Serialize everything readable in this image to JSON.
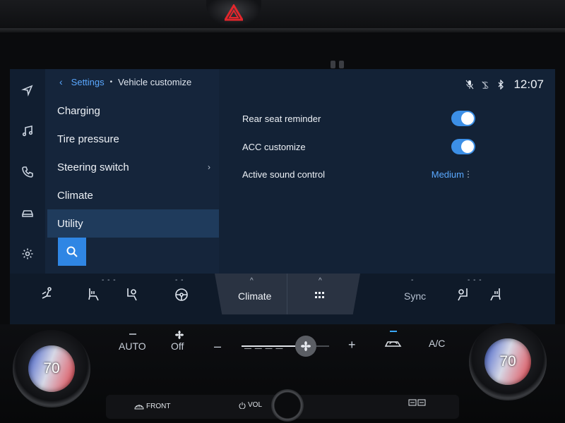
{
  "hazard": {
    "icon": "hazard-icon"
  },
  "breadcrumb": {
    "back_icon": "‹",
    "parent": "Settings",
    "separator": "•",
    "current": "Vehicle customize"
  },
  "side_rail": [
    {
      "icon": "navigation-icon"
    },
    {
      "icon": "music-icon"
    },
    {
      "icon": "phone-icon"
    },
    {
      "icon": "car-icon"
    },
    {
      "icon": "gear-icon"
    }
  ],
  "menu": {
    "items": [
      {
        "label": "Charging"
      },
      {
        "label": "Tire pressure"
      },
      {
        "label": "Steering switch",
        "chevron": "›"
      },
      {
        "label": "Climate"
      },
      {
        "label": "Utility",
        "selected": true
      }
    ]
  },
  "status": {
    "clock": "12:07",
    "icons": [
      "microphone-muted-icon",
      "signal-off-icon",
      "bluetooth-icon"
    ]
  },
  "settings": [
    {
      "label": "Rear seat reminder",
      "type": "toggle",
      "value": true
    },
    {
      "label": "ACC customize",
      "type": "toggle",
      "value": true
    },
    {
      "label": "Active sound control",
      "type": "select",
      "value": "Medium",
      "more": "⋮"
    }
  ],
  "climate_strip": {
    "tabs": [
      {
        "label": "Climate",
        "caret": "^"
      },
      {
        "label": "",
        "caret": "^",
        "icon": "grid-icon"
      }
    ],
    "sync_label": "Sync",
    "level_marks": {
      "left_seat_heat": "- - -",
      "steering": "- -",
      "sync": "-",
      "right_seat_heat": "- - -"
    }
  },
  "controls": {
    "left_temp": "70",
    "right_temp": "70",
    "auto_label": "AUTO",
    "fan_label": "Off",
    "minus": "–",
    "plus": "+",
    "ac_label": "A/C",
    "front_label": "FRONT",
    "vol_label": "VOL",
    "fan_dash": "— — — —",
    "fan_level": 0.7
  },
  "colors": {
    "accent": "#3c8fe6",
    "link": "#5aa8ff",
    "hazard": "#e3262c"
  }
}
